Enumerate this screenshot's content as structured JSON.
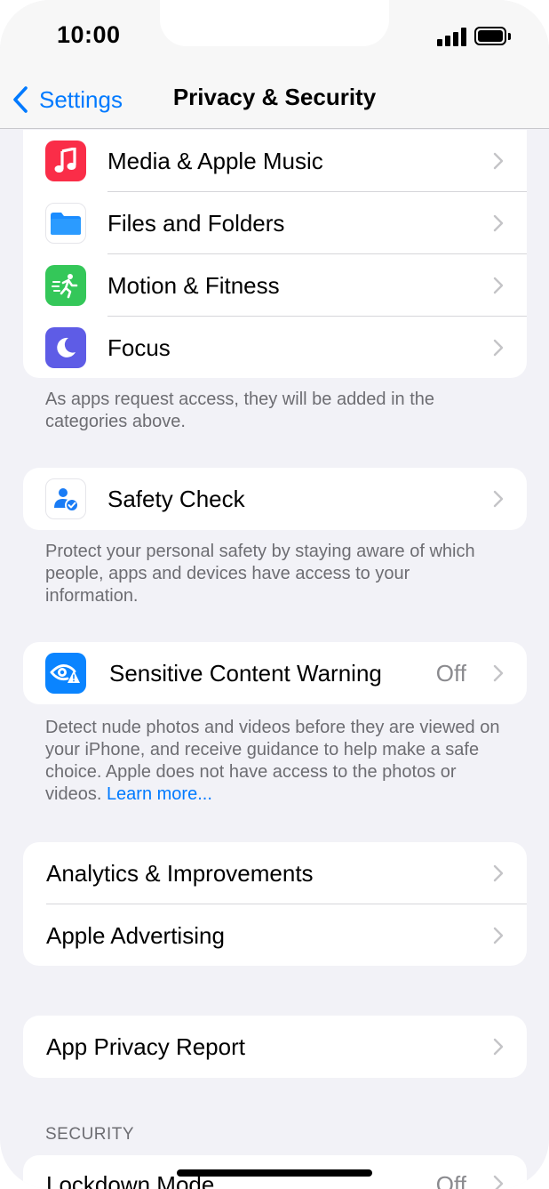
{
  "status_bar": {
    "time": "10:00",
    "battery_level": 1.0
  },
  "nav": {
    "back_label": "Settings",
    "title": "Privacy & Security"
  },
  "group_apps": {
    "items": [
      {
        "label": "Media & Apple Music",
        "icon": "music-note-icon",
        "color": "#fa2d48"
      },
      {
        "label": "Files and Folders",
        "icon": "folder-icon",
        "color": "#1a8cff"
      },
      {
        "label": "Motion & Fitness",
        "icon": "running-figure-icon",
        "color": "#34c759"
      },
      {
        "label": "Focus",
        "icon": "moon-icon",
        "color": "#5e5ce6"
      }
    ],
    "footnote": "As apps request access, they will be added in the categories above."
  },
  "safety_check": {
    "label": "Safety Check",
    "icon": "person-shield-icon",
    "footnote": "Protect your personal safety by staying aware of which people, apps and devices have access to your information."
  },
  "sensitive_content": {
    "label": "Sensitive Content Warning",
    "value": "Off",
    "icon": "eye-warning-icon",
    "footnote": "Detect nude photos and videos before they are viewed on your iPhone, and receive guidance to help make a safe choice. Apple does not have access to the photos or videos.",
    "footnote_link": "Learn more..."
  },
  "group_analytics": {
    "items": [
      {
        "label": "Analytics & Improvements"
      },
      {
        "label": "Apple Advertising"
      }
    ]
  },
  "app_privacy_report": {
    "label": "App Privacy Report"
  },
  "security": {
    "header": "SECURITY",
    "lockdown_label": "Lockdown Mode",
    "lockdown_value": "Off"
  },
  "colors": {
    "accent": "#007aff",
    "background": "#f2f2f7"
  }
}
